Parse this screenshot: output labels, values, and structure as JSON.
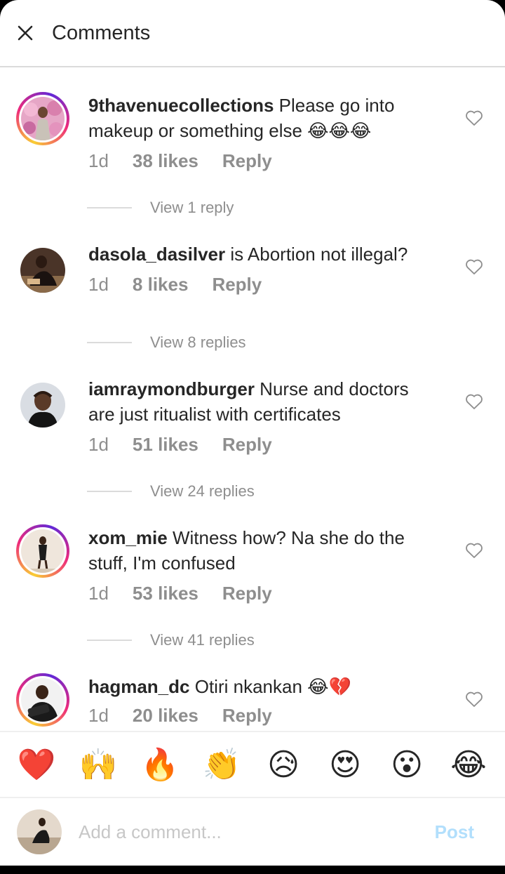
{
  "header": {
    "title": "Comments"
  },
  "comments": [
    {
      "username": "9thavenuecollections",
      "text": " Please go into makeup or something else ",
      "emojis": "😂😂😂",
      "time": "1d",
      "likes": "38 likes",
      "reply": "Reply",
      "view_replies": "View 1 reply",
      "has_story": true
    },
    {
      "username": "dasola_dasilver",
      "text": " is Abortion not illegal?",
      "emojis": "",
      "time": "1d",
      "likes": "8 likes",
      "reply": "Reply",
      "view_replies": "View 8 replies",
      "has_story": false
    },
    {
      "username": "iamraymondburger",
      "text": " Nurse and doctors are just ritualist with certificates",
      "emojis": "",
      "time": "1d",
      "likes": "51 likes",
      "reply": "Reply",
      "view_replies": "View 24 replies",
      "has_story": false
    },
    {
      "username": "xom_mie",
      "text": " Witness how? Na she do the stuff, I'm confused",
      "emojis": "",
      "time": "1d",
      "likes": "53 likes",
      "reply": "Reply",
      "view_replies": "View 41 replies",
      "has_story": true
    },
    {
      "username": "hagman_dc",
      "text": " Otiri nkankan ",
      "emojis": "😂💔",
      "time": "1d",
      "likes": "20 likes",
      "reply": "Reply",
      "view_replies": "",
      "has_story": true
    }
  ],
  "reactions": [
    "❤️",
    "🙌",
    "🔥",
    "👏",
    "😥",
    "😍",
    "😮",
    "😂"
  ],
  "composer": {
    "placeholder": "Add a comment...",
    "post_label": "Post"
  },
  "colors": {
    "text": "#262626",
    "secondary": "#8e8e8e",
    "divider": "#dbdbdb",
    "post": "#b2dffc"
  }
}
